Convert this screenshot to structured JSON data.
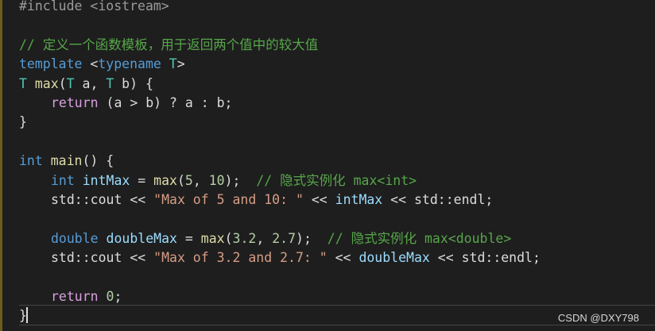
{
  "code": {
    "l1_include": "#include <iostream>",
    "l3_comment": "// 定义一个函数模板，用于返回两个值中的较大值",
    "l4_template": "template",
    "l4_open": " <",
    "l4_typename": "typename",
    "l4_T": " T",
    "l4_close": ">",
    "l5_T": "T",
    "l5_max": " max",
    "l5_open": "(",
    "l5_T2": "T",
    "l5_a": " a",
    "l5_comma": ", ",
    "l5_T3": "T",
    "l5_b": " b",
    "l5_close": ") {",
    "l6_return": "return",
    "l6_expr": " (a > b) ? a : b;",
    "l7_brace": "}",
    "l9_int": "int",
    "l9_main": " main",
    "l9_rest": "() {",
    "l10_int": "int",
    "l10_intMax": " intMax",
    "l10_eq": " = ",
    "l10_max": "max",
    "l10_open": "(",
    "l10_n1": "5",
    "l10_comma": ", ",
    "l10_n2": "10",
    "l10_close": ");  ",
    "l10_comment": "// 隐式实例化 max<int>",
    "l11_cout": "std::cout << ",
    "l11_str": "\"Max of 5 and 10: \"",
    "l11_op": " << ",
    "l11_var": "intMax",
    "l11_endl": " << std::endl;",
    "l13_double": "double",
    "l13_doubleMax": " doubleMax",
    "l13_eq": " = ",
    "l13_max": "max",
    "l13_open": "(",
    "l13_n1": "3.2",
    "l13_comma": ", ",
    "l13_n2": "2.7",
    "l13_close": ");  ",
    "l13_comment": "// 隐式实例化 max<double>",
    "l14_cout": "std::cout << ",
    "l14_str": "\"Max of 3.2 and 2.7: \"",
    "l14_op": " << ",
    "l14_var": "doubleMax",
    "l14_endl": " << std::endl;",
    "l16_return": "return",
    "l16_zero": " 0",
    "l16_semi": ";",
    "l17_brace": "}"
  },
  "watermark": "CSDN @DXY798",
  "colors": {
    "background": "#1e1e1e",
    "keyword": "#569cd6",
    "comment": "#57a64a",
    "string": "#d69d85",
    "function": "#dcdcaa",
    "type": "#4ec9b0",
    "number": "#b5cea8",
    "control": "#d8a0df"
  }
}
